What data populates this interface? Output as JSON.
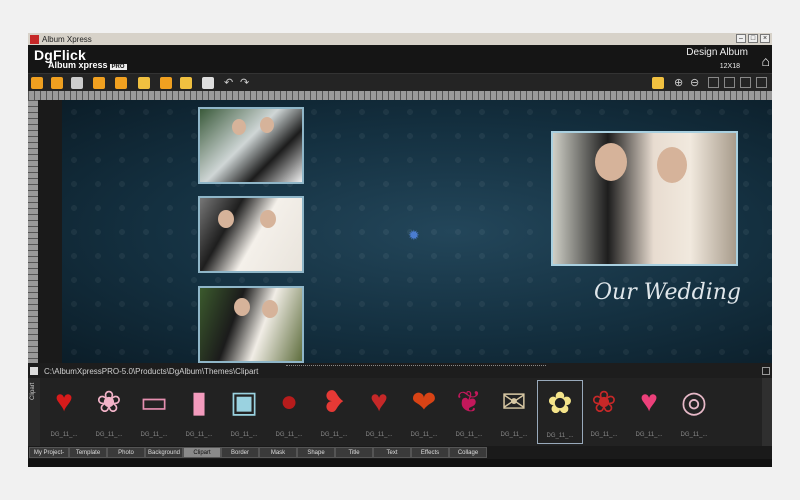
{
  "window": {
    "title": "Album Xpress"
  },
  "header": {
    "brand": "DgFlick",
    "product": "Album xpress",
    "pro_badge": "PRO",
    "design_title": "Design Album",
    "album_size": "12X18"
  },
  "canvas": {
    "title_text": "Our Wedding"
  },
  "clipart": {
    "path": "C:\\AlbumXpressPRO-5.0\\Products\\DgAlbum\\Themes\\Clipart",
    "side_label": "Clipart",
    "items": [
      {
        "label": "DG_11_...",
        "icon": "red-heart"
      },
      {
        "label": "DG_11_...",
        "icon": "heart-badge"
      },
      {
        "label": "DG_11_...",
        "icon": "pink-card"
      },
      {
        "label": "DG_11_...",
        "icon": "pink-tag"
      },
      {
        "label": "DG_11_...",
        "icon": "frame-card"
      },
      {
        "label": "DG_11_...",
        "icon": "heart-seal"
      },
      {
        "label": "DG_11_...",
        "icon": "double-heart"
      },
      {
        "label": "DG_11_...",
        "icon": "heart-pair"
      },
      {
        "label": "DG_11_...",
        "icon": "heart-ring"
      },
      {
        "label": "DG_11_...",
        "icon": "rose-heart"
      },
      {
        "label": "DG_11_...",
        "icon": "wedding-card"
      },
      {
        "label": "DG_11_...",
        "icon": "flower-bouquet"
      },
      {
        "label": "DG_11_...",
        "icon": "red-rose"
      },
      {
        "label": "DG_11_...",
        "icon": "pink-heart"
      },
      {
        "label": "DG_11_...",
        "icon": "wedding-rings"
      }
    ]
  },
  "tabs": [
    {
      "label": "My Project-0..."
    },
    {
      "label": "Template"
    },
    {
      "label": "Photo"
    },
    {
      "label": "Background"
    },
    {
      "label": "Clipart",
      "active": true
    },
    {
      "label": "Border"
    },
    {
      "label": "Mask"
    },
    {
      "label": "Shape"
    },
    {
      "label": "Title"
    },
    {
      "label": "Text"
    },
    {
      "label": "Effects"
    },
    {
      "label": "Collage"
    }
  ],
  "colors": {
    "canvas_bg": "#143040",
    "accent": "#4a7cd0",
    "logo_red": "#d32f2f"
  }
}
